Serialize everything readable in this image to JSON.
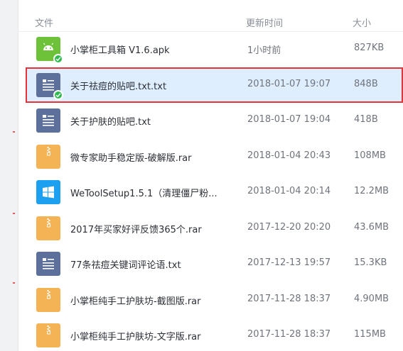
{
  "header": {
    "col_name": "文件",
    "col_time": "更新时间",
    "col_size": "大小"
  },
  "colors": {
    "selection_border": "#e5333b",
    "selection_fill": "#dfeeff",
    "apk_icon": "#6ec23a",
    "txt_icon": "#5d6f9b",
    "rar_icon": "#f4b354",
    "exe_icon": "#1ea0f0",
    "check_badge": "#2dbb4e"
  },
  "files": [
    {
      "name": "小掌柜工具箱 V1.6.apk",
      "time": "1小时前",
      "size": "827KB",
      "icon": "android-apk-icon",
      "synced": true,
      "selected": false
    },
    {
      "name": "关于祛痘的贴吧.txt.txt",
      "time": "2018-01-07 19:07",
      "size": "848B",
      "icon": "text-document-icon",
      "synced": true,
      "selected": true
    },
    {
      "name": "关于护肤的贴吧.txt",
      "time": "2018-01-07 19:04",
      "size": "418B",
      "icon": "text-document-icon",
      "synced": false,
      "selected": false
    },
    {
      "name": "微专家助手稳定版-破解版.rar",
      "time": "2018-01-04 20:43",
      "size": "108MB",
      "icon": "archive-zip-icon",
      "synced": false,
      "selected": false
    },
    {
      "name": "WeToolSetup1.5.1（清理僵尸粉...",
      "time": "2018-01-04 20:14",
      "size": "12.2MB",
      "icon": "windows-installer-icon",
      "synced": false,
      "selected": false
    },
    {
      "name": "2017年买家好评反馈365个.rar",
      "time": "2017-12-20 20:20",
      "size": "43.6MB",
      "icon": "archive-zip-icon",
      "synced": false,
      "selected": false
    },
    {
      "name": "77条祛痘关键词评论语.txt",
      "time": "2017-12-13 19:57",
      "size": "15.3KB",
      "icon": "text-document-icon",
      "synced": false,
      "selected": false
    },
    {
      "name": "小掌柜纯手工护肤坊-截图版.rar",
      "time": "2017-11-28 18:37",
      "size": "4.90MB",
      "icon": "archive-zip-icon",
      "synced": false,
      "selected": false
    },
    {
      "name": "小掌柜纯手工护肤坊-文字版.rar",
      "time": "2017-11-28 18:37",
      "size": "115MB",
      "icon": "archive-zip-icon",
      "synced": false,
      "selected": false
    }
  ]
}
